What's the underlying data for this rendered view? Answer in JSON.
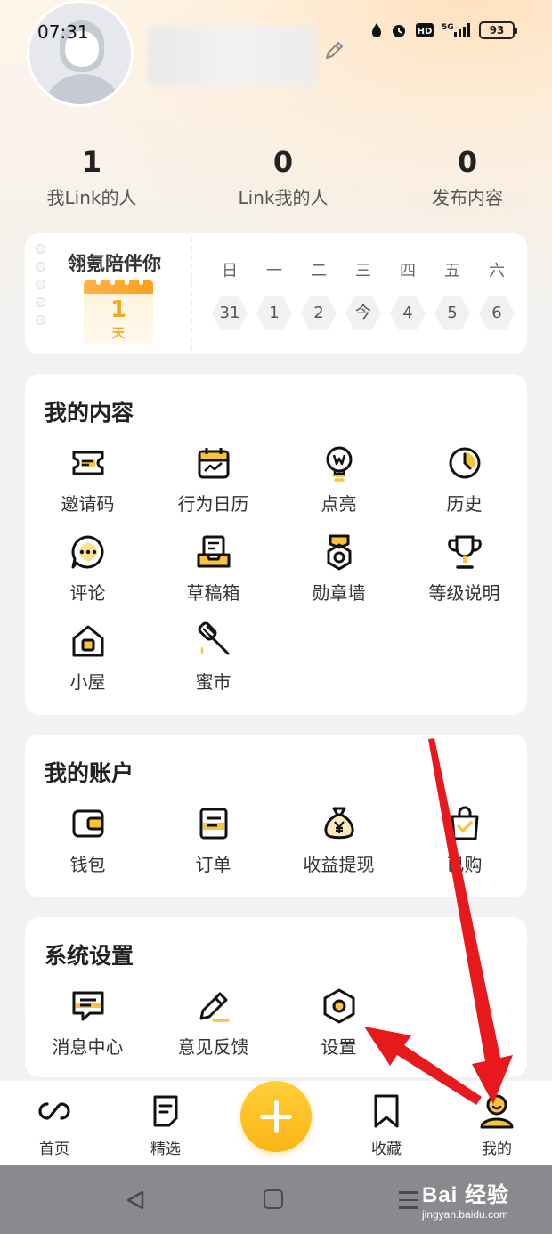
{
  "status_bar": {
    "time": "07:31",
    "battery": "93"
  },
  "profile": {
    "stats": [
      {
        "value": "1",
        "label": "我Link的人"
      },
      {
        "value": "0",
        "label": "Link我的人"
      },
      {
        "value": "0",
        "label": "发布内容"
      }
    ]
  },
  "calendar": {
    "title": "翎氪陪伴你",
    "streak_value": "1",
    "streak_unit": "天",
    "weekdays": [
      "日",
      "一",
      "二",
      "三",
      "四",
      "五",
      "六"
    ],
    "days": [
      "31",
      "1",
      "2",
      "今",
      "4",
      "5",
      "6"
    ]
  },
  "my_content": {
    "title": "我的内容",
    "items": [
      "邀请码",
      "行为日历",
      "点亮",
      "历史",
      "评论",
      "草稿箱",
      "勋章墙",
      "等级说明",
      "小屋",
      "蜜市"
    ]
  },
  "my_account": {
    "title": "我的账户",
    "items": [
      "钱包",
      "订单",
      "收益提现",
      "已购"
    ]
  },
  "system_settings": {
    "title": "系统设置",
    "items": [
      "消息中心",
      "意见反馈",
      "设置"
    ]
  },
  "bottom_nav": {
    "items": [
      "首页",
      "精选",
      "收藏",
      "我的"
    ]
  },
  "watermark": {
    "brand": "Bai 经验",
    "url": "jingyan.baidu.com"
  },
  "colors": {
    "accent": "#f9b515",
    "annotation_arrow": "#e8191c"
  }
}
